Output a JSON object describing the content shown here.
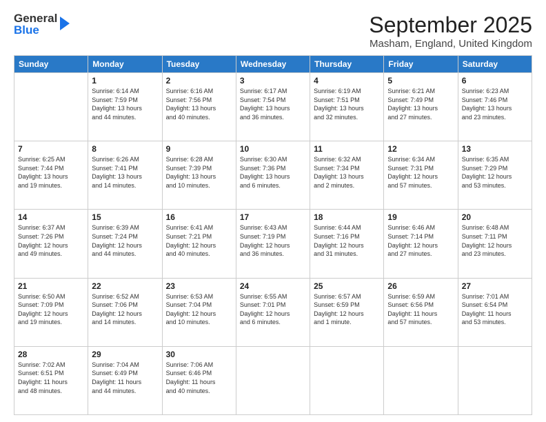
{
  "logo": {
    "general": "General",
    "blue": "Blue"
  },
  "header": {
    "month": "September 2025",
    "location": "Masham, England, United Kingdom"
  },
  "days_of_week": [
    "Sunday",
    "Monday",
    "Tuesday",
    "Wednesday",
    "Thursday",
    "Friday",
    "Saturday"
  ],
  "weeks": [
    [
      {
        "day": "",
        "info": ""
      },
      {
        "day": "1",
        "info": "Sunrise: 6:14 AM\nSunset: 7:59 PM\nDaylight: 13 hours\nand 44 minutes."
      },
      {
        "day": "2",
        "info": "Sunrise: 6:16 AM\nSunset: 7:56 PM\nDaylight: 13 hours\nand 40 minutes."
      },
      {
        "day": "3",
        "info": "Sunrise: 6:17 AM\nSunset: 7:54 PM\nDaylight: 13 hours\nand 36 minutes."
      },
      {
        "day": "4",
        "info": "Sunrise: 6:19 AM\nSunset: 7:51 PM\nDaylight: 13 hours\nand 32 minutes."
      },
      {
        "day": "5",
        "info": "Sunrise: 6:21 AM\nSunset: 7:49 PM\nDaylight: 13 hours\nand 27 minutes."
      },
      {
        "day": "6",
        "info": "Sunrise: 6:23 AM\nSunset: 7:46 PM\nDaylight: 13 hours\nand 23 minutes."
      }
    ],
    [
      {
        "day": "7",
        "info": "Sunrise: 6:25 AM\nSunset: 7:44 PM\nDaylight: 13 hours\nand 19 minutes."
      },
      {
        "day": "8",
        "info": "Sunrise: 6:26 AM\nSunset: 7:41 PM\nDaylight: 13 hours\nand 14 minutes."
      },
      {
        "day": "9",
        "info": "Sunrise: 6:28 AM\nSunset: 7:39 PM\nDaylight: 13 hours\nand 10 minutes."
      },
      {
        "day": "10",
        "info": "Sunrise: 6:30 AM\nSunset: 7:36 PM\nDaylight: 13 hours\nand 6 minutes."
      },
      {
        "day": "11",
        "info": "Sunrise: 6:32 AM\nSunset: 7:34 PM\nDaylight: 13 hours\nand 2 minutes."
      },
      {
        "day": "12",
        "info": "Sunrise: 6:34 AM\nSunset: 7:31 PM\nDaylight: 12 hours\nand 57 minutes."
      },
      {
        "day": "13",
        "info": "Sunrise: 6:35 AM\nSunset: 7:29 PM\nDaylight: 12 hours\nand 53 minutes."
      }
    ],
    [
      {
        "day": "14",
        "info": "Sunrise: 6:37 AM\nSunset: 7:26 PM\nDaylight: 12 hours\nand 49 minutes."
      },
      {
        "day": "15",
        "info": "Sunrise: 6:39 AM\nSunset: 7:24 PM\nDaylight: 12 hours\nand 44 minutes."
      },
      {
        "day": "16",
        "info": "Sunrise: 6:41 AM\nSunset: 7:21 PM\nDaylight: 12 hours\nand 40 minutes."
      },
      {
        "day": "17",
        "info": "Sunrise: 6:43 AM\nSunset: 7:19 PM\nDaylight: 12 hours\nand 36 minutes."
      },
      {
        "day": "18",
        "info": "Sunrise: 6:44 AM\nSunset: 7:16 PM\nDaylight: 12 hours\nand 31 minutes."
      },
      {
        "day": "19",
        "info": "Sunrise: 6:46 AM\nSunset: 7:14 PM\nDaylight: 12 hours\nand 27 minutes."
      },
      {
        "day": "20",
        "info": "Sunrise: 6:48 AM\nSunset: 7:11 PM\nDaylight: 12 hours\nand 23 minutes."
      }
    ],
    [
      {
        "day": "21",
        "info": "Sunrise: 6:50 AM\nSunset: 7:09 PM\nDaylight: 12 hours\nand 19 minutes."
      },
      {
        "day": "22",
        "info": "Sunrise: 6:52 AM\nSunset: 7:06 PM\nDaylight: 12 hours\nand 14 minutes."
      },
      {
        "day": "23",
        "info": "Sunrise: 6:53 AM\nSunset: 7:04 PM\nDaylight: 12 hours\nand 10 minutes."
      },
      {
        "day": "24",
        "info": "Sunrise: 6:55 AM\nSunset: 7:01 PM\nDaylight: 12 hours\nand 6 minutes."
      },
      {
        "day": "25",
        "info": "Sunrise: 6:57 AM\nSunset: 6:59 PM\nDaylight: 12 hours\nand 1 minute."
      },
      {
        "day": "26",
        "info": "Sunrise: 6:59 AM\nSunset: 6:56 PM\nDaylight: 11 hours\nand 57 minutes."
      },
      {
        "day": "27",
        "info": "Sunrise: 7:01 AM\nSunset: 6:54 PM\nDaylight: 11 hours\nand 53 minutes."
      }
    ],
    [
      {
        "day": "28",
        "info": "Sunrise: 7:02 AM\nSunset: 6:51 PM\nDaylight: 11 hours\nand 48 minutes."
      },
      {
        "day": "29",
        "info": "Sunrise: 7:04 AM\nSunset: 6:49 PM\nDaylight: 11 hours\nand 44 minutes."
      },
      {
        "day": "30",
        "info": "Sunrise: 7:06 AM\nSunset: 6:46 PM\nDaylight: 11 hours\nand 40 minutes."
      },
      {
        "day": "",
        "info": ""
      },
      {
        "day": "",
        "info": ""
      },
      {
        "day": "",
        "info": ""
      },
      {
        "day": "",
        "info": ""
      }
    ]
  ]
}
